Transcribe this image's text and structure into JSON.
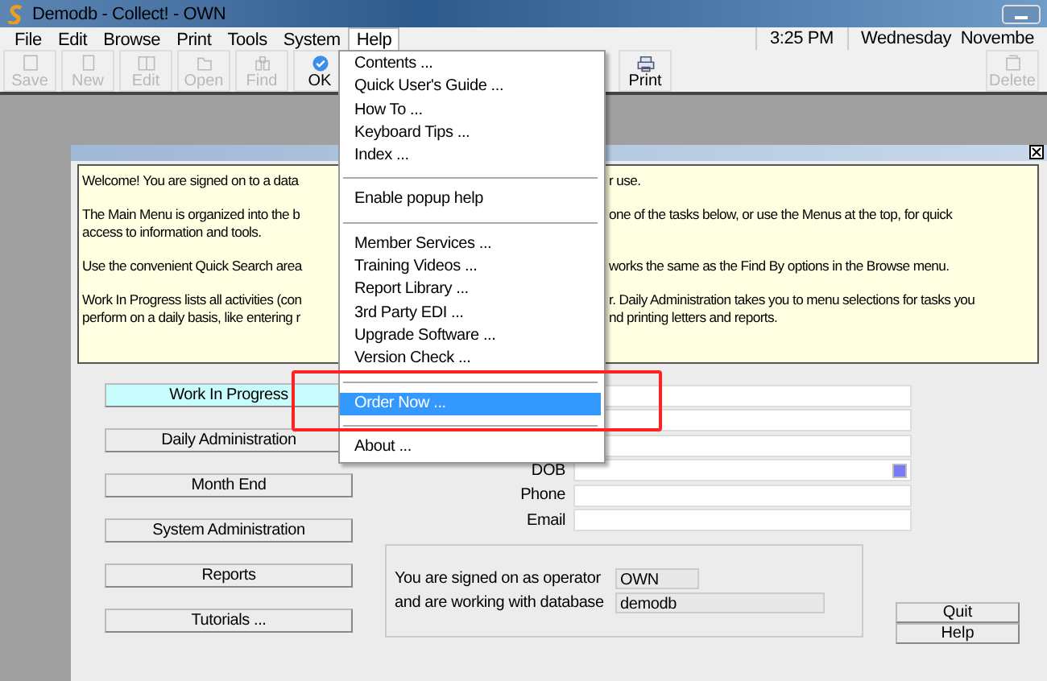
{
  "window": {
    "title": "Demodb - Collect! - OWN"
  },
  "menu_bar": [
    {
      "label": "File",
      "selected": false
    },
    {
      "label": "Edit",
      "selected": false
    },
    {
      "label": "Browse",
      "selected": false
    },
    {
      "label": "Print",
      "selected": false
    },
    {
      "label": "Tools",
      "selected": false
    },
    {
      "label": "System",
      "selected": false
    },
    {
      "label": "Help",
      "selected": true
    }
  ],
  "clock": {
    "time": "3:25 PM",
    "date": "Wednesday  Novembe"
  },
  "toolbar_left": [
    {
      "label": "Save",
      "disabled": true
    },
    {
      "label": "New",
      "disabled": true
    },
    {
      "label": "Edit",
      "disabled": true
    },
    {
      "label": "Open",
      "disabled": true
    },
    {
      "label": "Find",
      "disabled": true
    },
    {
      "label": "OK",
      "disabled": false
    },
    {
      "label": "Print",
      "disabled": false
    }
  ],
  "toolbar_right": [
    {
      "label": "Delete",
      "disabled": true
    }
  ],
  "help_menu": [
    {
      "kind": "item",
      "label": "Contents ...",
      "selected": false
    },
    {
      "kind": "item",
      "label": "Quick User's Guide ...",
      "selected": false
    },
    {
      "kind": "item",
      "label": "How To ...",
      "selected": false
    },
    {
      "kind": "item",
      "label": "Keyboard Tips ...",
      "selected": false
    },
    {
      "kind": "item",
      "label": "Index ...",
      "selected": false
    },
    {
      "kind": "separator"
    },
    {
      "kind": "item",
      "label": "Enable popup help",
      "selected": false
    },
    {
      "kind": "separator"
    },
    {
      "kind": "item",
      "label": "Member Services ...",
      "selected": false
    },
    {
      "kind": "item",
      "label": "Training Videos ...",
      "selected": false
    },
    {
      "kind": "item",
      "label": "Report Library ...",
      "selected": false
    },
    {
      "kind": "item",
      "label": "3rd Party EDI ...",
      "selected": false
    },
    {
      "kind": "item",
      "label": "Upgrade Software ...",
      "selected": false
    },
    {
      "kind": "item",
      "label": "Version Check ...",
      "selected": false
    },
    {
      "kind": "separator"
    },
    {
      "kind": "item",
      "label": "Order Now ...",
      "selected": true
    },
    {
      "kind": "separator"
    },
    {
      "kind": "item",
      "label": "About ...",
      "selected": false
    }
  ],
  "welcome": [
    {
      "lines": [
        {
          "left": "Welcome! You are signed on to a data",
          "right": "r use."
        }
      ]
    },
    {
      "lines": [
        {
          "left": "The Main Menu is organized into the b",
          "right": "one of the tasks below, or use the Menus at the top, for quick"
        },
        {
          "left": "access to information and tools."
        }
      ]
    },
    {
      "lines": [
        {
          "left": "Use the convenient Quick Search area",
          "right": "works the same as the Find By options in the Browse menu."
        }
      ]
    },
    {
      "lines": [
        {
          "left": "Work In Progress lists all activities (con",
          "right": "r. Daily Administration takes you to menu selections for tasks you"
        },
        {
          "left": "perform on a daily basis, like entering r",
          "right": "nd printing letters and reports."
        }
      ]
    }
  ],
  "nav_buttons": [
    {
      "label": "Work In Progress",
      "selected": true
    },
    {
      "label": "Daily Administration",
      "selected": false
    },
    {
      "label": "Month End",
      "selected": false
    },
    {
      "label": "System Administration",
      "selected": false
    },
    {
      "label": "Reports",
      "selected": false
    },
    {
      "label": "Tutorials ...",
      "selected": false
    }
  ],
  "search_fields": [
    {
      "kind": "text"
    },
    {
      "kind": "text"
    },
    {
      "kind": "text"
    },
    {
      "label": "DOB",
      "kind": "date"
    },
    {
      "label": "Phone",
      "kind": "text"
    },
    {
      "label": "Email",
      "kind": "text"
    }
  ],
  "sign_on": [
    {
      "label": "You are signed on as operator",
      "value": "OWN"
    },
    {
      "label": "and are working with database",
      "value": "demodb"
    }
  ],
  "action_buttons": [
    "Quit",
    "Help"
  ]
}
